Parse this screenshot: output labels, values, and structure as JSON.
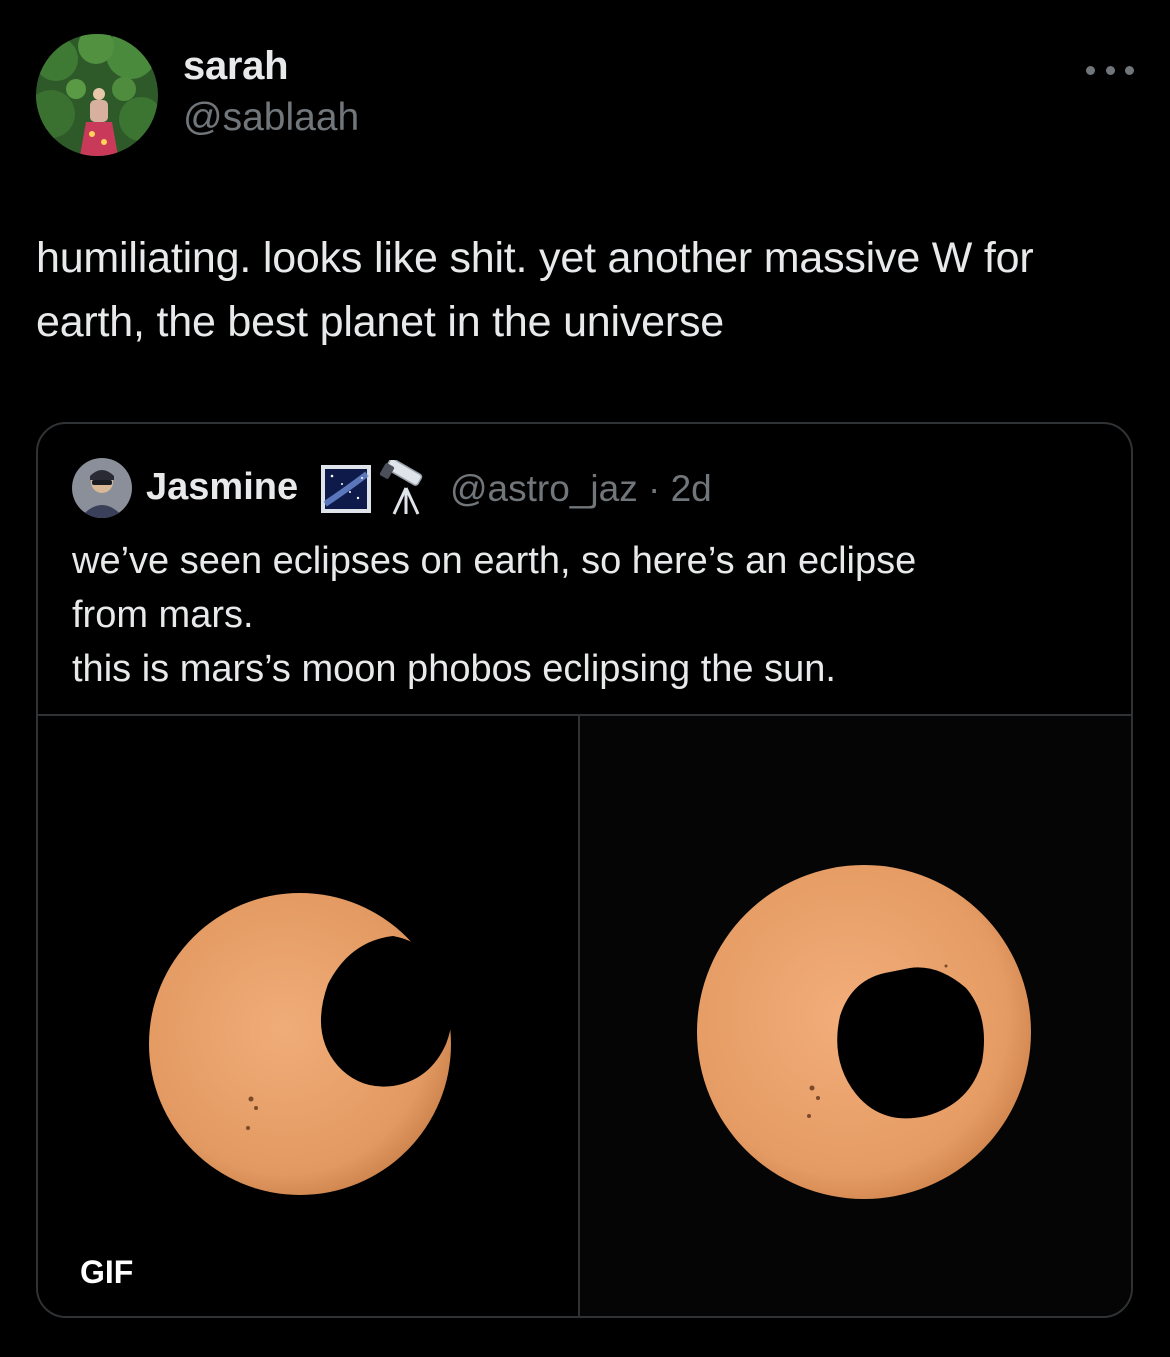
{
  "author": {
    "name": "sarah",
    "handle": "@sablaah"
  },
  "tweet": {
    "text": "humiliating. looks like shit. yet another massive W for earth, the best planet in the universe"
  },
  "quoted": {
    "name": "Jasmine",
    "emojis": [
      "milky-way-icon",
      "telescope-icon"
    ],
    "handle_time": "@astro_jaz · 2d",
    "lines": [
      "we’ve seen eclipses on earth, so here’s an eclipse",
      "from mars.",
      "this is mars’s moon phobos eclipsing the sun."
    ],
    "media": {
      "left_badge": "GIF"
    }
  },
  "colors": {
    "background": "#000000",
    "text": "#e7e9ea",
    "secondary": "#71767b",
    "border": "#2f3336",
    "sun": "#e8a06c"
  }
}
